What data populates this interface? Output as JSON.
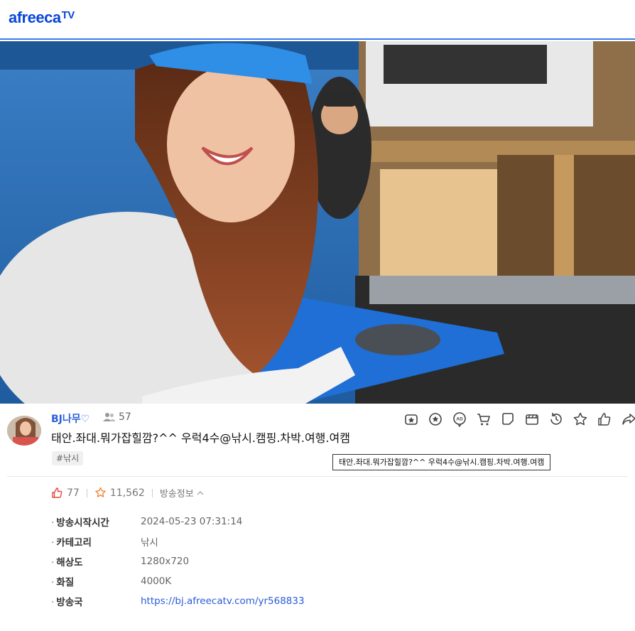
{
  "header": {
    "logo_text": "afreeca",
    "logo_tv": "TV"
  },
  "broadcast": {
    "bj_name": "BJ나무♡",
    "viewer_count": "57",
    "title": "태안.좌대.뭐가잡힐깜?^^ 우럭4수@낚시.캠핑.차박.여행.여캠",
    "tag": "#낚시",
    "tooltip": "태안.좌대.뭐가잡힐깜?^^ 우럭4수@낚시.캠핑.차박.여행.여캠"
  },
  "toolbar": {
    "icons": [
      "star-balloon-icon",
      "sticker-icon",
      "ad-balloon-icon",
      "cart-icon",
      "chat-bubble-icon",
      "clip-icon",
      "history-icon",
      "favorite-star-icon",
      "thumbs-up-icon",
      "share-icon"
    ]
  },
  "stats": {
    "up_count": "77",
    "favorite_count": "11,562",
    "info_label": "방송정보"
  },
  "details": [
    {
      "key": "방송시작시간",
      "value": "2024-05-23 07:31:14"
    },
    {
      "key": "카테고리",
      "value": "낚시"
    },
    {
      "key": "해상도",
      "value": "1280x720"
    },
    {
      "key": "화질",
      "value": "4000K"
    },
    {
      "key": "방송국",
      "value": "https://bj.afreecatv.com/yr568833"
    }
  ],
  "colors": {
    "brand": "#0a47d6",
    "link": "#2a5bd7",
    "up": "#e8443f",
    "favorite": "#f0883a"
  }
}
